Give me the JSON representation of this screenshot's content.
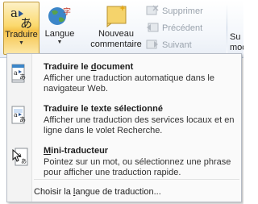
{
  "ribbon": {
    "translate": {
      "label": "Traduire",
      "icon": "translate-icon"
    },
    "language": {
      "label": "Langue",
      "icon": "language-icon"
    },
    "new_comment": {
      "label_line1": "Nouveau",
      "label_line2": "commentaire",
      "icon": "new-comment-icon"
    },
    "delete": {
      "label": "Supprimer",
      "icon": "delete-comment-icon",
      "enabled": false
    },
    "previous": {
      "label": "Précédent",
      "icon": "previous-comment-icon",
      "enabled": false
    },
    "next": {
      "label": "Suivant",
      "icon": "next-comment-icon",
      "enabled": false
    },
    "cut_label_1": "Su",
    "cut_label_2": "modi"
  },
  "menu": {
    "items": [
      {
        "title_before": "Traduire le ",
        "title_accel": "d",
        "title_after": "ocument",
        "description": "Afficher une traduction automatique dans le navigateur Web.",
        "icon": "translate-document-icon"
      },
      {
        "title": "Traduire le texte sélectionné",
        "description": "Afficher une traduction des services locaux et en ligne dans le volet Recherche.",
        "icon": "translate-selection-icon"
      },
      {
        "title_accel": "M",
        "title_after": "ini-traducteur",
        "description": "Pointez sur un mot, ou sélectionnez une phrase pour afficher une traduction rapide.",
        "icon": "mini-translator-icon"
      }
    ],
    "choose_before": "Choisir la ",
    "choose_accel": "l",
    "choose_after": "angue de traduction..."
  },
  "colors": {
    "accent_blue": "#2b5797",
    "highlight_gold": "#fbd96e",
    "disabled_text": "#9aa3ad"
  }
}
